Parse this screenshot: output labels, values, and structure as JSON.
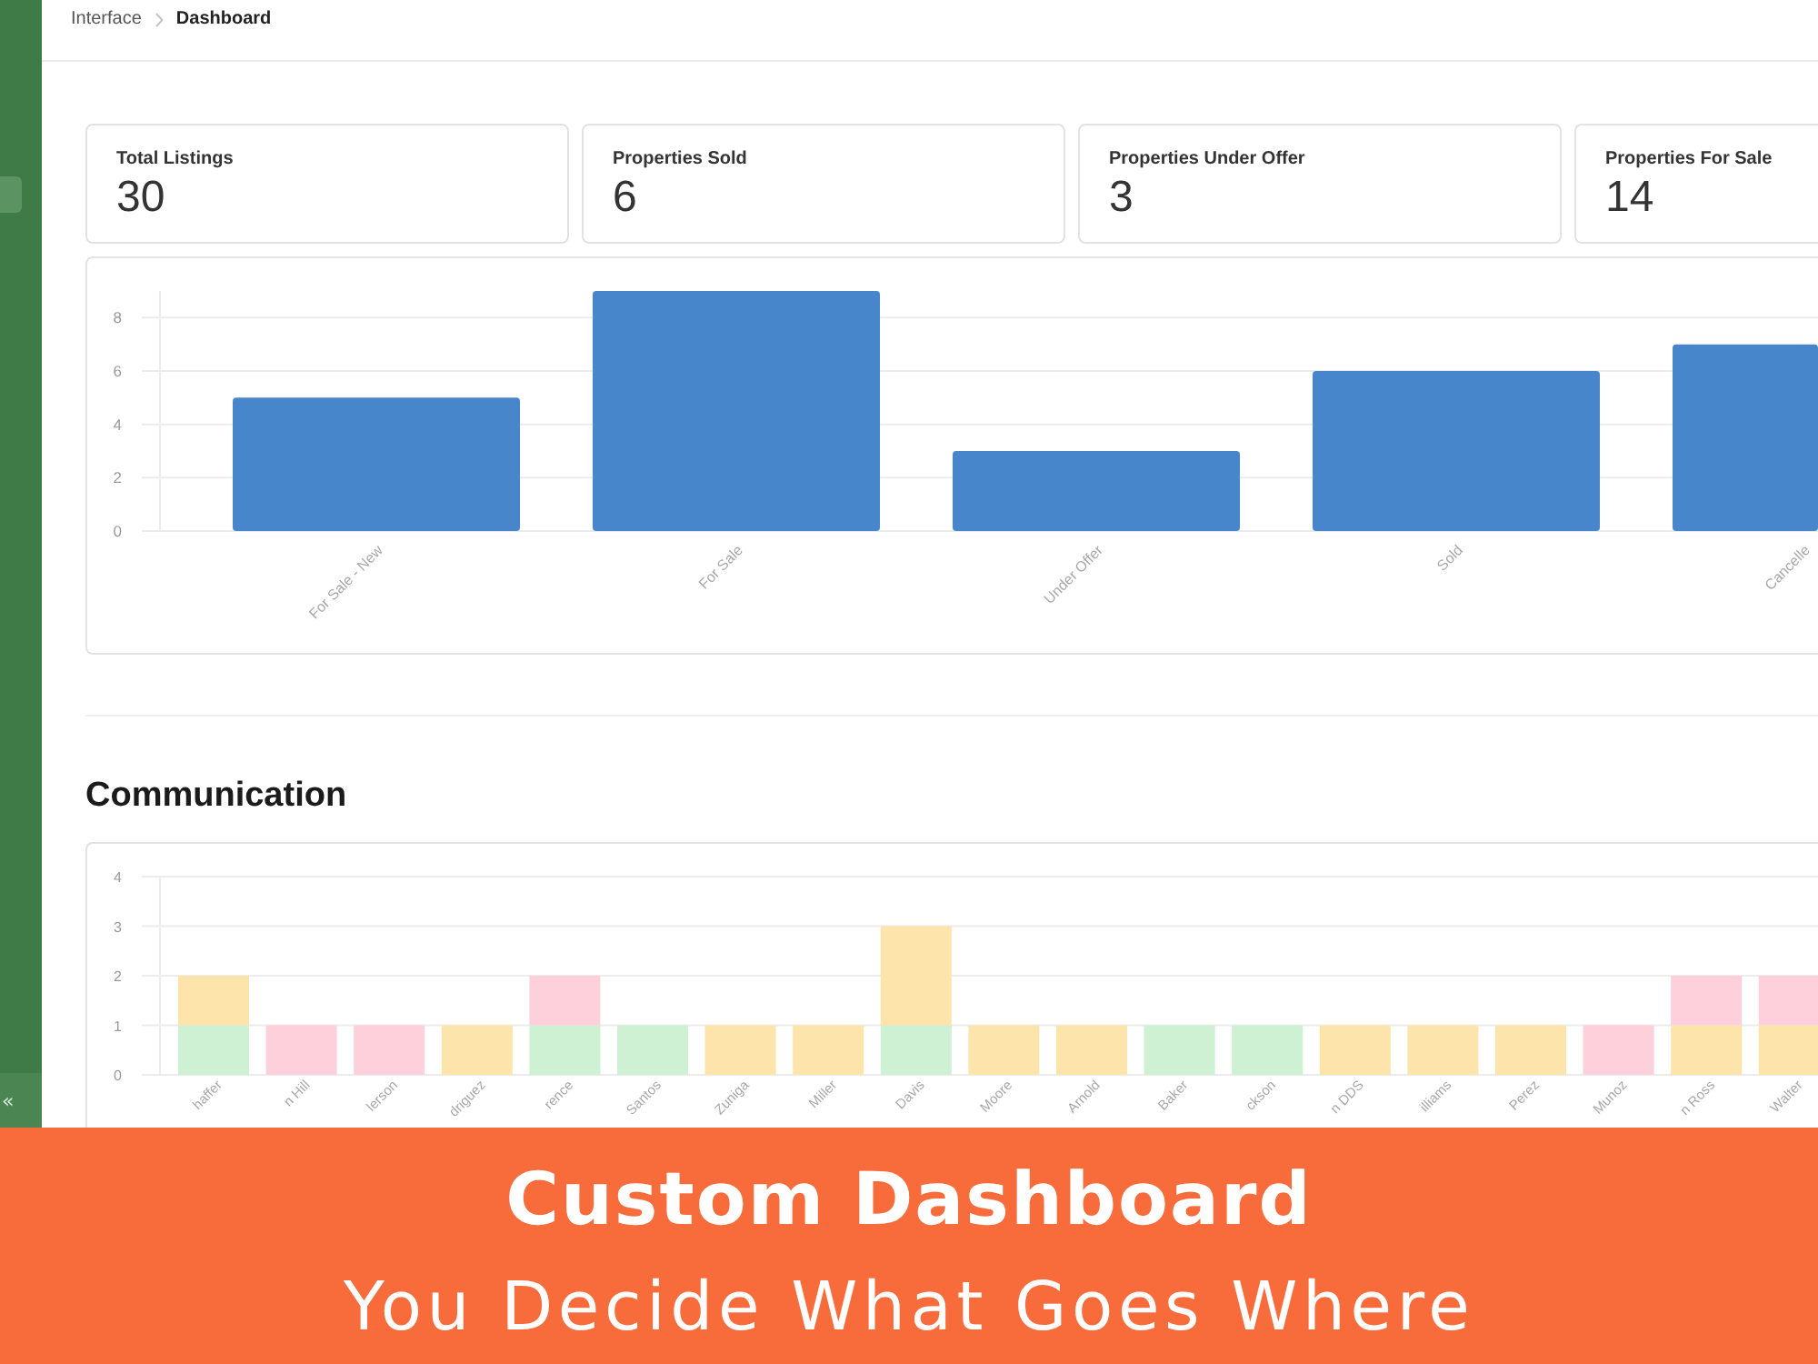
{
  "sidebar": {
    "collapse_button": "«"
  },
  "breadcrumb": [
    "Interface",
    "Dashboard"
  ],
  "stats": [
    {
      "label": "Total Listings",
      "value": "30"
    },
    {
      "label": "Properties Sold",
      "value": "6"
    },
    {
      "label": "Properties Under Offer",
      "value": "3"
    },
    {
      "label": "Properties For Sale",
      "value": "14"
    }
  ],
  "status_chart": {
    "chart_data": {
      "type": "bar",
      "categories": [
        "For Sale - New",
        "For Sale",
        "Under Offer",
        "Sold",
        "Cancelle"
      ],
      "values": [
        5,
        9,
        3,
        6,
        7
      ],
      "ylim": [
        0,
        9
      ],
      "yticks": [
        0,
        2,
        4,
        6,
        8
      ],
      "grid": true
    }
  },
  "communication": {
    "title": "Communication",
    "chart_data": {
      "type": "bar",
      "stacked": true,
      "categories": [
        "haffer",
        "n Hill",
        "lerson",
        "driguez",
        "rence",
        "Santos",
        "Zuniga",
        "Miller",
        "Davis",
        "Moore",
        "Arnold",
        "Baker",
        "ckson",
        "n DDS",
        "illiams",
        "Perez",
        "Munoz",
        "n Ross",
        "Walter"
      ],
      "series": [
        {
          "color": "#cdf1d2",
          "values": [
            1,
            0,
            0,
            0,
            1,
            1,
            0,
            0,
            1,
            0,
            0,
            1,
            1,
            0,
            0,
            0,
            0,
            0,
            0
          ]
        },
        {
          "color": "#fde4aa",
          "values": [
            1,
            0,
            0,
            1,
            0,
            0,
            1,
            1,
            2,
            1,
            1,
            0,
            0,
            1,
            1,
            1,
            0,
            1,
            1
          ]
        },
        {
          "color": "#fdd0dc",
          "values": [
            0,
            1,
            1,
            0,
            1,
            0,
            0,
            0,
            0,
            0,
            0,
            0,
            0,
            0,
            0,
            0,
            1,
            1,
            1
          ]
        }
      ],
      "ylim": [
        0,
        4
      ],
      "yticks": [
        0,
        1,
        2,
        3,
        4
      ],
      "grid": true
    }
  },
  "banner": {
    "title": "Custom Dashboard",
    "subtitle": "You Decide What Goes Where"
  }
}
